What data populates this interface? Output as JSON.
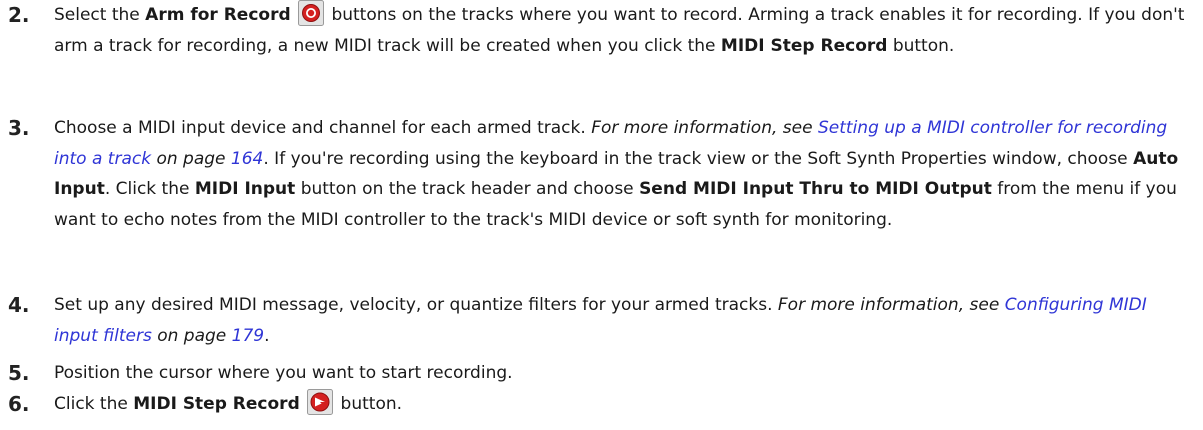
{
  "steps": [
    {
      "number": "2.",
      "t1": "Select the ",
      "b1": "Arm for Record",
      "t2": " buttons on the tracks where you want to record. Arming a track enables it for recording. If you don't arm a track for recording, a new MIDI track will be created when you click the ",
      "b2": "MIDI Step Record",
      "t3": " button."
    },
    {
      "number": "3.",
      "t1": "Choose a MIDI input device and channel for each armed track. ",
      "i1": "For more information, see ",
      "link": "Setting up a MIDI controller for recording into a track",
      "i2": " on page ",
      "page": "164",
      "t2": ". If you're recording using the keyboard in the track view or the Soft Synth Properties window, choose ",
      "b1": "Auto Input",
      "t3": ". Click the ",
      "b2": "MIDI Input",
      "t4": " button on the track header and choose ",
      "b3": "Send MIDI Input Thru to MIDI Output",
      "t5": " from the menu if you want to echo notes from the MIDI controller to the track's MIDI device or soft synth for monitoring."
    },
    {
      "number": "4.",
      "t1": "Set up any desired MIDI message, velocity, or quantize filters for your armed tracks. ",
      "i1": "For more information, see ",
      "link": "Configuring MIDI input filters",
      "i2": " on page ",
      "page": "179",
      "t2": "."
    },
    {
      "number": "5.",
      "t1": "Position the cursor where you want to start recording."
    },
    {
      "number": "6.",
      "t1": "Click the ",
      "b1": "MIDI Step Record",
      "t2": " button."
    }
  ],
  "icons": {
    "arm_record": "arm-for-record-icon",
    "step_record": "midi-step-record-icon"
  },
  "colors": {
    "link": "#2f35d6",
    "record_red": "#d42020"
  }
}
